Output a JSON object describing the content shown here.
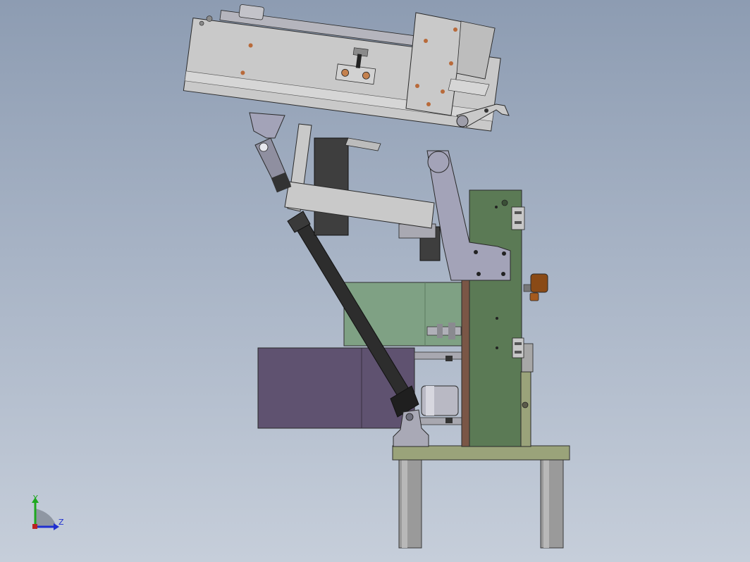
{
  "view": {
    "background_top": "#8d9cb2",
    "background_bottom": "#c6ceda"
  },
  "model": {
    "colors": {
      "frame_grey": "#c9c9c9",
      "plate_green": "#5b7a55",
      "plate_green_light": "#7fa184",
      "block_purple": "#5f5270",
      "base_olive": "#9aa37a",
      "brace_dark": "#2d2d2d",
      "brown_knob": "#8a4a16",
      "link_lavender": "#a3a3b8",
      "leg_grey": "#9a9a9a"
    }
  },
  "triad": {
    "y_label": "Y",
    "z_label": "Z",
    "y_color": "#1fa81f",
    "z_color": "#1f2fd0"
  }
}
